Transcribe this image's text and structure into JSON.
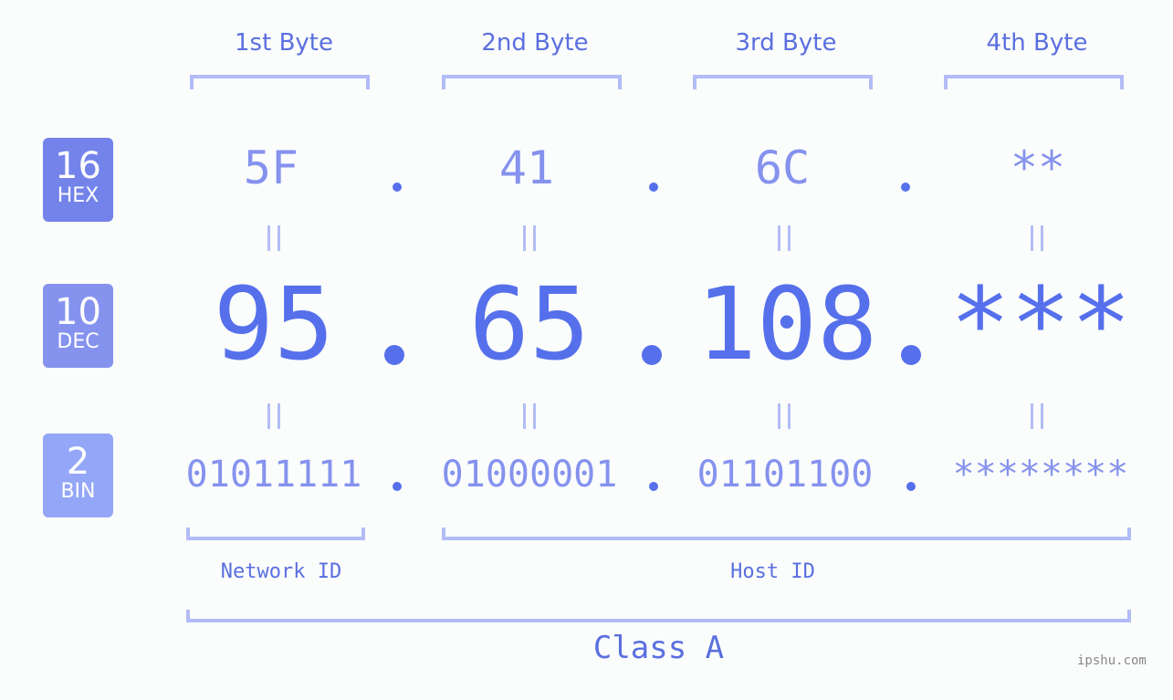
{
  "headers": [
    "1st Byte",
    "2nd Byte",
    "3rd Byte",
    "4th Byte"
  ],
  "badges": {
    "hex": {
      "number": "16",
      "label": "HEX",
      "color": "#7383ea"
    },
    "dec": {
      "number": "10",
      "label": "DEC",
      "color": "#8592ee"
    },
    "bin": {
      "number": "2",
      "label": "BIN",
      "color": "#93a6f7"
    }
  },
  "hex_values": [
    "5F",
    "41",
    "6C",
    "**"
  ],
  "dec_values": [
    "95",
    "65",
    "108",
    "***"
  ],
  "bin_values": [
    "01011111",
    "01000001",
    "01101100",
    "********"
  ],
  "sections": {
    "network": "Network ID",
    "host": "Host ID",
    "class": "Class A"
  },
  "watermark": "ipshu.com",
  "colors": {
    "accent": "#5670ec",
    "light_accent": "#8592ee",
    "bracket": "#b2bcf6",
    "background": "#fbfdfc"
  }
}
